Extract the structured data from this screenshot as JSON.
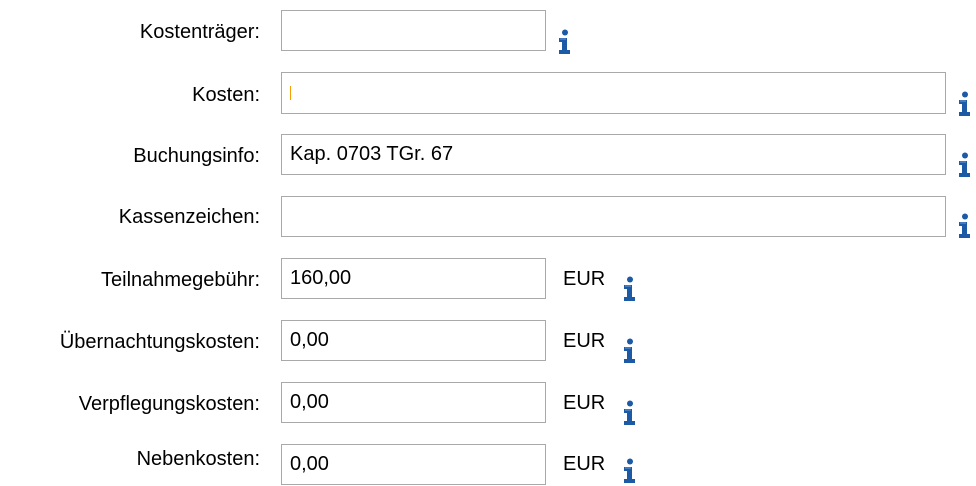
{
  "form": {
    "cost_bearer": {
      "label": "Kostenträger:",
      "value": ""
    },
    "costs": {
      "label": "Kosten:",
      "value": ""
    },
    "booking_info": {
      "label": "Buchungsinfo:",
      "value": "Kap. 0703 TGr. 67"
    },
    "cash_reference": {
      "label": "Kassenzeichen:",
      "value": ""
    },
    "participation_fee": {
      "label": "Teilnahmegebühr:",
      "value": "160,00",
      "unit": "EUR"
    },
    "accommodation_costs": {
      "label": "Übernachtungskosten:",
      "value": "0,00",
      "unit": "EUR"
    },
    "catering_costs": {
      "label": "Verpflegungskosten:",
      "value": "0,00",
      "unit": "EUR"
    },
    "additional_costs": {
      "label": "Nebenkosten:",
      "value": "0,00",
      "unit": "EUR"
    }
  },
  "icons": {
    "info": "info-icon"
  },
  "colors": {
    "info_icon": "#1c5aa6",
    "field_border": "#a9a9a9",
    "cursor_accent": "#f5a000"
  }
}
